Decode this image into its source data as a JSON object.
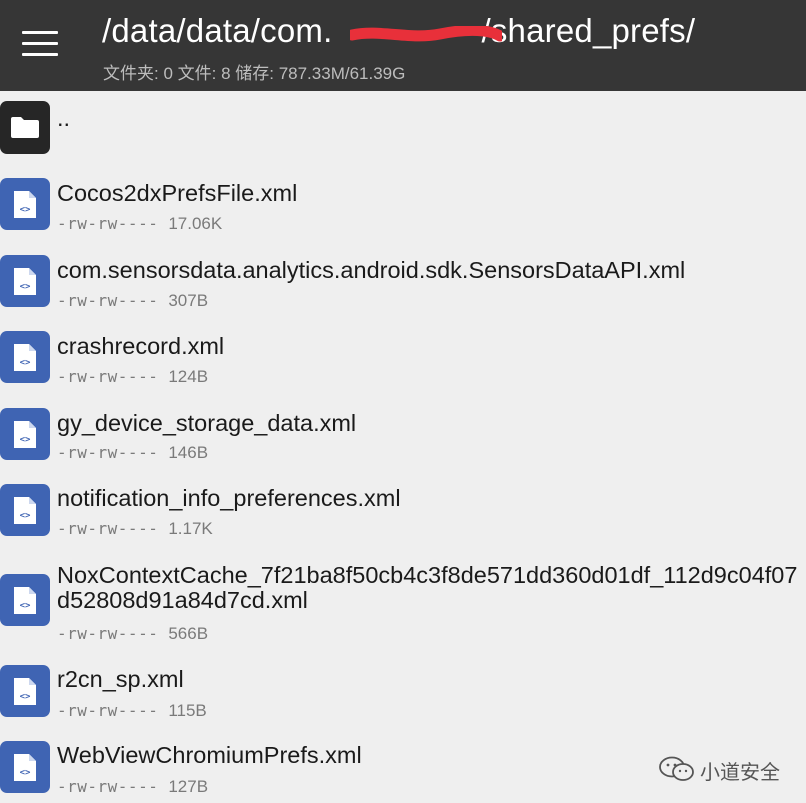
{
  "header": {
    "path_prefix": "/data/data/com.",
    "path_suffix": "/shared_prefs/",
    "stats": "文件夹: 0  文件: 8  储存: 787.33M/61.39G",
    "redaction_color": "#e8303a"
  },
  "parent": {
    "label": ".."
  },
  "files": [
    {
      "name": "Cocos2dxPrefsFile.xml",
      "perm": "-rw-rw----",
      "size": "17.06K"
    },
    {
      "name": "com.sensorsdata.analytics.android.sdk.SensorsDataAPI.xml",
      "perm": "-rw-rw----",
      "size": "307B"
    },
    {
      "name": "crashrecord.xml",
      "perm": "-rw-rw----",
      "size": "124B"
    },
    {
      "name": "gy_device_storage_data.xml",
      "perm": "-rw-rw----",
      "size": "146B"
    },
    {
      "name": "notification_info_preferences.xml",
      "perm": "-rw-rw----",
      "size": "1.17K"
    },
    {
      "name": "NoxContextCache_7f21ba8f50cb4c3f8de571dd360d01df_112d9c04f07d52808d91a84d7cd.xml",
      "perm": "-rw-rw----",
      "size": "566B"
    },
    {
      "name": "r2cn_sp.xml",
      "perm": "-rw-rw----",
      "size": "115B"
    },
    {
      "name": "WebViewChromiumPrefs.xml",
      "perm": "-rw-rw----",
      "size": "127B"
    }
  ],
  "icons": {
    "menu": "hamburger-menu-icon",
    "folder": "folder-icon",
    "file": "xml-file-icon"
  },
  "colors": {
    "header_bg": "#363636",
    "file_icon_bg": "#3f64b3",
    "folder_icon_bg": "#262626",
    "list_bg": "#efefef"
  },
  "watermark": {
    "text": "小道安全"
  }
}
